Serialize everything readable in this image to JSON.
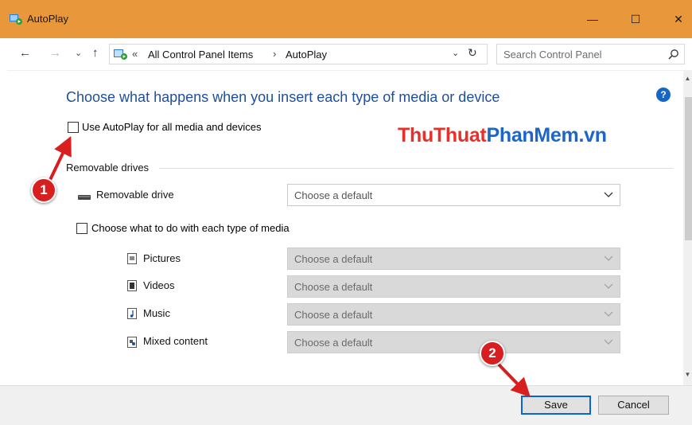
{
  "window": {
    "title": "AutoPlay",
    "controls": {
      "minimize": "—",
      "maximize": "☐",
      "close": "✕"
    },
    "title_bar_color": "#e8973b"
  },
  "navigation": {
    "back": "←",
    "forward": "→",
    "recent": "⌄",
    "up": "↑",
    "breadcrumb_prefix": "«",
    "breadcrumbs": [
      "All Control Panel Items",
      "AutoPlay"
    ],
    "breadcrumb_separator": "›",
    "dropdown_glyph": "⌄",
    "refresh_glyph": "↻",
    "search_placeholder": "Search Control Panel"
  },
  "main": {
    "heading": "Choose what happens when you insert each type of media or device",
    "help_glyph": "?",
    "use_autoplay_label": "Use AutoPlay for all media and devices",
    "use_autoplay_checked": false,
    "watermark": {
      "part1": "ThuThuat",
      "part2": "PhanMem.vn"
    },
    "removable_group_label": "Removable drives",
    "removable_drive": {
      "label": "Removable drive",
      "value": "Choose a default",
      "enabled": true
    },
    "media_checkbox_label": "Choose what to do with each type of media",
    "media_checkbox_checked": false,
    "media_types": [
      {
        "label": "Pictures",
        "icon": "pictures-icon",
        "value": "Choose a default",
        "enabled": false
      },
      {
        "label": "Videos",
        "icon": "videos-icon",
        "value": "Choose a default",
        "enabled": false
      },
      {
        "label": "Music",
        "icon": "music-icon",
        "value": "Choose a default",
        "enabled": false
      },
      {
        "label": "Mixed content",
        "icon": "mixed-content-icon",
        "value": "Choose a default",
        "enabled": false
      }
    ]
  },
  "footer": {
    "save_label": "Save",
    "cancel_label": "Cancel"
  },
  "annotations": {
    "step1": "1",
    "step2": "2",
    "color": "#d81e1e"
  },
  "colors": {
    "heading": "#1f4e9c",
    "save_border": "#0a64d2",
    "watermark_red": "#e8302a",
    "watermark_blue": "#1b66c9"
  }
}
